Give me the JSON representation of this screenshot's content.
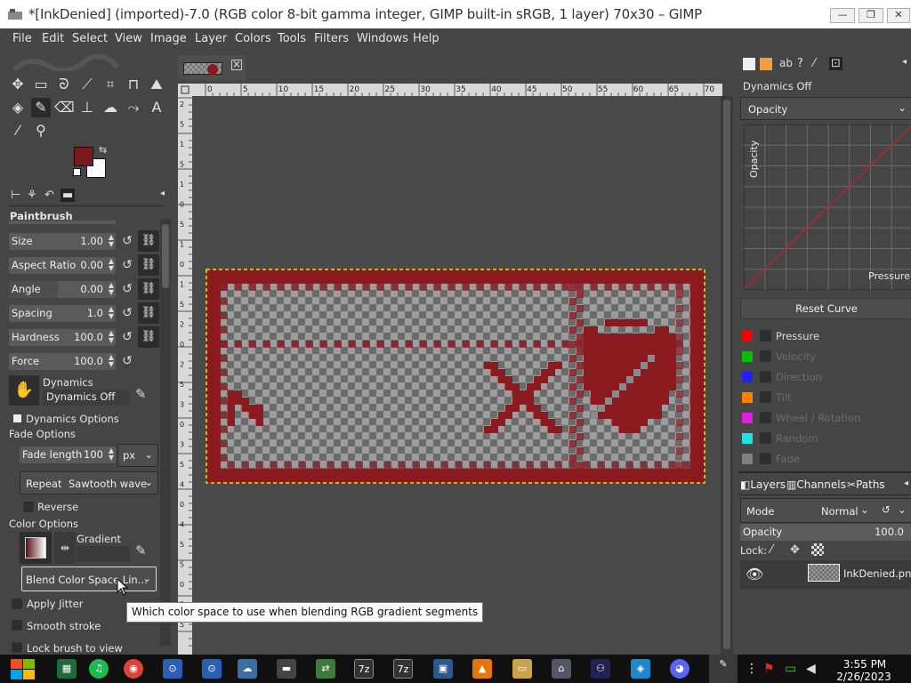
{
  "window": {
    "title": "*[InkDenied] (imported)-7.0 (RGB color 8-bit gamma integer, GIMP built-in sRGB, 1 layer) 70x30 – GIMP",
    "min_label": "—",
    "max_label": "❐",
    "close_label": "✕"
  },
  "menu": {
    "file": "File",
    "edit": "Edit",
    "select": "Select",
    "view": "View",
    "image": "Image",
    "layer": "Layer",
    "colors": "Colors",
    "tools": "Tools",
    "filters": "Filters",
    "windows": "Windows",
    "help": "Help"
  },
  "colors": {
    "foreground": "#7a1a1e",
    "background": "#ffffff",
    "accent_red": "#8b1a1f"
  },
  "tool_options": {
    "title": "Paintbrush",
    "size": {
      "label": "Size",
      "value": "1.00"
    },
    "aspect": {
      "label": "Aspect Ratio",
      "value": "0.00"
    },
    "angle": {
      "label": "Angle",
      "value": "0.00"
    },
    "spacing": {
      "label": "Spacing",
      "value": "1.0"
    },
    "hardness": {
      "label": "Hardness",
      "value": "100.0"
    },
    "force": {
      "label": "Force",
      "value": "100.0"
    },
    "dynamics_label": "Dynamics",
    "dynamics_value": "Dynamics Off",
    "dynamics_options": "Dynamics Options",
    "fade_options": "Fade Options",
    "fade_length_label": "Fade length",
    "fade_length_value": "100",
    "fade_unit": "px",
    "repeat_label": "Repeat",
    "repeat_value": "Sawtooth wave",
    "reverse": "Reverse",
    "color_options": "Color Options",
    "gradient_label": "Gradient",
    "blend_value": "Blend Color Space Lin...",
    "apply_jitter": "Apply Jitter",
    "smooth_stroke": "Smooth stroke",
    "lock_brush": "Lock brush to view"
  },
  "tooltip": "Which color space to use when blending RGB gradient segments",
  "ruler_top": [
    "0",
    "5",
    "10",
    "15",
    "20",
    "25",
    "30",
    "35",
    "40",
    "45",
    "50",
    "55",
    "60",
    "65",
    "70"
  ],
  "ruler_left": [
    "2",
    "5",
    "1",
    "5",
    "1",
    "0",
    "5",
    "1",
    "0",
    "1",
    "5",
    "2",
    "0",
    "2",
    "5",
    "3",
    "0",
    "3",
    "5",
    "4",
    "0",
    "4",
    "5",
    "5",
    "0",
    "5",
    "5"
  ],
  "dynamics_panel": {
    "title": "Dynamics Off",
    "select": "Opacity",
    "curve_y": "Opacity",
    "curve_x": "Pressure",
    "reset": "Reset Curve",
    "channels": [
      {
        "name": "Pressure",
        "color": "#ff0000",
        "enabled": true
      },
      {
        "name": "Velocity",
        "color": "#00c000",
        "enabled": false
      },
      {
        "name": "Direction",
        "color": "#2020ff",
        "enabled": false
      },
      {
        "name": "Tilt",
        "color": "#ff8000",
        "enabled": false
      },
      {
        "name": "Wheel / Rotation",
        "color": "#e020e0",
        "enabled": false
      },
      {
        "name": "Random",
        "color": "#20e0e0",
        "enabled": false
      },
      {
        "name": "Fade",
        "color": "#808080",
        "enabled": false
      }
    ]
  },
  "layers_panel": {
    "tabs": [
      "Layers",
      "Channels",
      "Paths"
    ],
    "mode_label": "Mode",
    "mode_value": "Normal",
    "opacity_label": "Opacity",
    "opacity_value": "100.0",
    "lock_label": "Lock:",
    "layer_name": "InkDenied.png"
  },
  "taskbar": {
    "time": "3:55 PM",
    "date": "2/26/2023",
    "zip1": "7z",
    "zip2": "7z"
  }
}
